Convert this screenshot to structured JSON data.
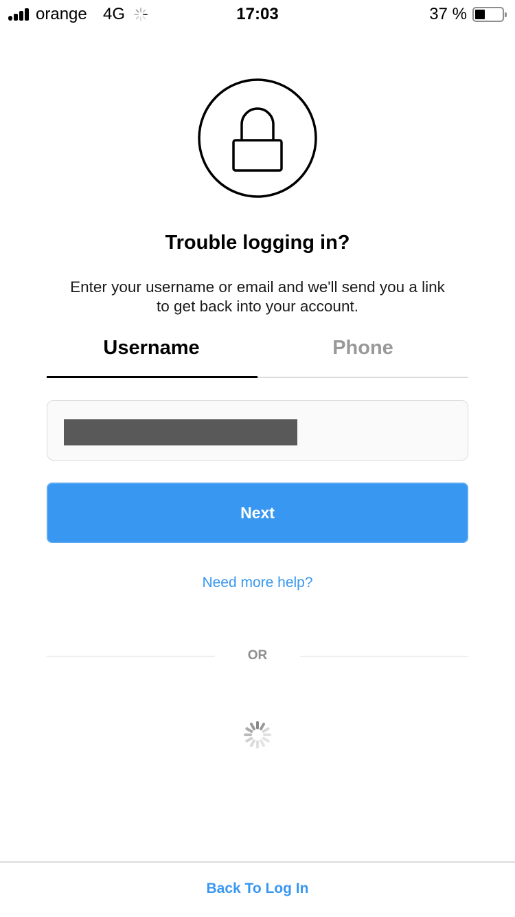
{
  "status_bar": {
    "carrier": "orange",
    "network": "4G",
    "time": "17:03",
    "battery_percent_label": "37 %",
    "battery_level": 0.37,
    "signal_bars": 4
  },
  "header": {
    "icon": "lock-icon",
    "title": "Trouble logging in?",
    "description": "Enter your username or email and we'll send you a link to get back into your account."
  },
  "tabs": [
    {
      "label": "Username",
      "active": true
    },
    {
      "label": "Phone",
      "active": false
    }
  ],
  "input": {
    "value": "[redacted]",
    "placeholder": ""
  },
  "actions": {
    "next_label": "Next",
    "help_label": "Need more help?",
    "divider_label": "OR",
    "back_label": "Back To Log In"
  },
  "colors": {
    "accent": "#3897f0",
    "border": "#dbdbdb",
    "muted_text": "#8e8e8e",
    "inactive_tab": "#999999"
  }
}
